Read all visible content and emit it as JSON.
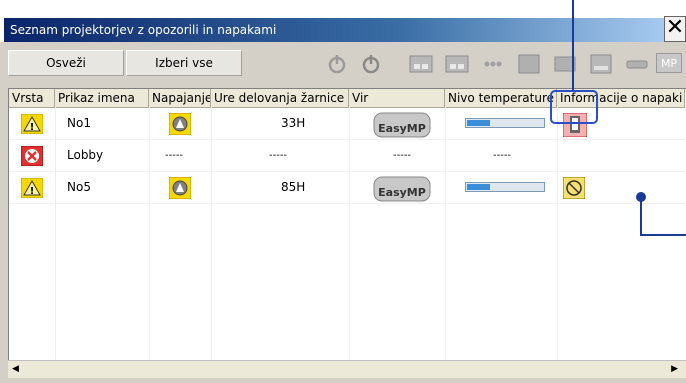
{
  "window": {
    "title": "Seznam projektorjev z opozorili in napakami",
    "close_glyph": "✕"
  },
  "toolbar": {
    "refresh_label": "Osveži",
    "select_all_label": "Izberi vse",
    "icons": [
      "power-on-icon",
      "power-off-icon",
      "input1-icon",
      "input2-icon",
      "input3-icon",
      "video-icon",
      "svideo-icon",
      "computer-icon",
      "usb-icon",
      "mp-icon"
    ],
    "mp_label": "MP"
  },
  "table": {
    "columns": [
      "Vrsta",
      "Prikaz imena",
      "Napajanje",
      "Ure delovanja žarnice",
      "Vir",
      "Nivo temperature",
      "Informacije o napaki"
    ],
    "rows": [
      {
        "type_icon": "warning-icon",
        "name": "No1",
        "power_icon": "power-warning-icon",
        "hours": "33H",
        "source": "EasyMP",
        "temp": 0.3,
        "error_icon": "lamp-error-icon"
      },
      {
        "type_icon": "error-icon",
        "name": "Lobby",
        "power": "-----",
        "hours": "-----",
        "source_text": "-----",
        "temp_text": "-----"
      },
      {
        "type_icon": "warning-icon",
        "name": "No5",
        "power_icon": "power-warning-icon",
        "hours": "85H",
        "source": "EasyMP",
        "temp": 0.3,
        "error_icon": "fan-error-icon"
      }
    ]
  },
  "colors": {
    "accent": "#2a4fc4",
    "warning": "#f5d800",
    "error": "#e03030"
  }
}
